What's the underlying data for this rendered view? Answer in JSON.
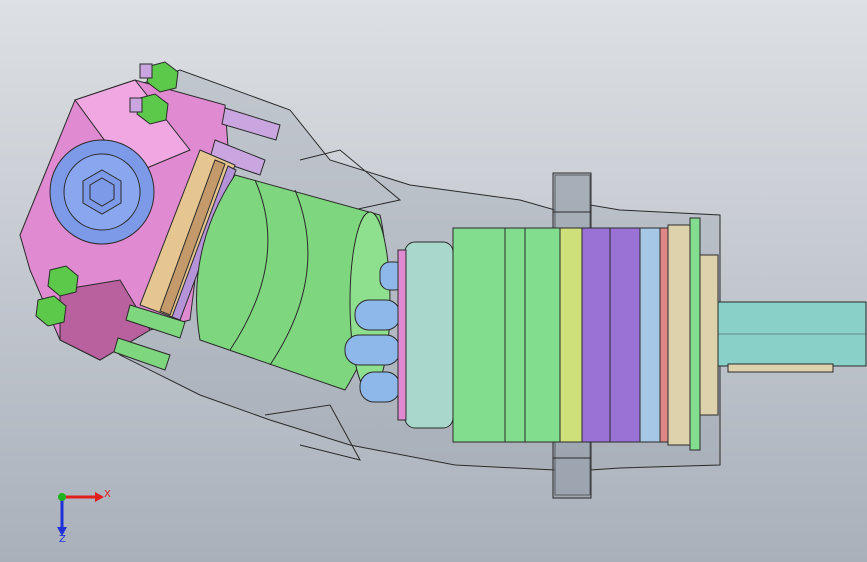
{
  "viewport": {
    "background_top": "#dde0e4",
    "background_bottom": "#a9b0ba"
  },
  "triad": {
    "x_label": "X",
    "z_label": "Z",
    "x_color": "#e0201e",
    "y_color": "#1eb41e",
    "z_color": "#2030d8"
  },
  "model_colors": {
    "housing_pink": "#e08ad2",
    "bolt_head_blue": "#7d9ae8",
    "nut_green": "#5cc94a",
    "stud_lavender": "#c9a6e0",
    "wedge_tan": "#e6c690",
    "barrel_green": "#7ed67e",
    "piston_blue": "#8fb8ea",
    "valve_plate": "#a8d8cc",
    "bearing_green": "#82dd8e",
    "ring_yellow": "#cde07a",
    "ring_purple": "#9a72d6",
    "ring_lightblue": "#a6c8e6",
    "ring_red": "#e08888",
    "ring_beige": "#ddd2ac",
    "shaft_teal": "#88d0c8",
    "outline": "#2a2a2a"
  }
}
